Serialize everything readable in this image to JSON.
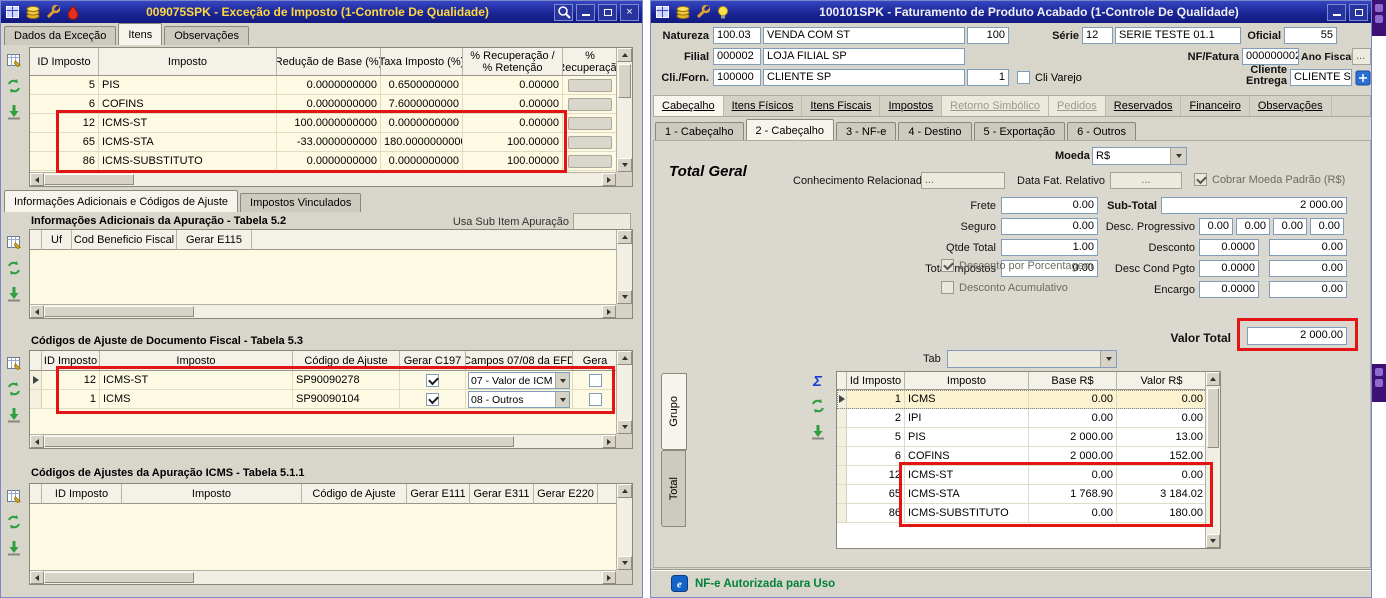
{
  "colors": {
    "highlight_red": "#e21414",
    "status_green": "#00833a",
    "titlebar_blue": "#1a2596",
    "grid_cream": "#fdf9e3"
  },
  "chrome": {
    "close_glyph": "×",
    "sum_icon_glyph": "Σ"
  },
  "left_window": {
    "title": "009075SPK - Exceção de Imposto (1-Controle De Qualidade)",
    "tabs": {
      "t1": "Dados da Exceção",
      "t2": "Itens",
      "t3": "Observações"
    },
    "impostos_grid": {
      "headers": {
        "id": "ID Imposto",
        "imposto": "Imposto",
        "reducao": "Redução de Base (%)",
        "taxa": "Taxa Imposto (%)",
        "recup_l1": "% Recuperação /",
        "recup_l2": "% Retenção",
        "recup2_l1": "%",
        "recup2_l2": "Recuperação"
      },
      "rows": [
        [
          "5",
          "PIS",
          "0.0000000000",
          "0.6500000000",
          "0.00000"
        ],
        [
          "6",
          "COFINS",
          "0.0000000000",
          "7.6000000000",
          "0.00000"
        ],
        [
          "12",
          "ICMS-ST",
          "100.0000000000",
          "0.0000000000",
          "0.00000"
        ],
        [
          "65",
          "ICMS-STA",
          "-33.0000000000",
          "180.0000000000",
          "100.00000"
        ],
        [
          "86",
          "ICMS-SUBSTITUTO",
          "0.0000000000",
          "0.0000000000",
          "100.00000"
        ]
      ]
    },
    "lower_tabs": {
      "t1": "Informações Adicionais e Códigos de Ajuste",
      "t2": "Impostos Vinculados"
    },
    "section_52": {
      "title": "Informações Adicionais da Apuração - Tabela 5.2",
      "right_label": "Usa Sub Item Apuração",
      "headers": {
        "uf": "Uf",
        "cod": "Cod Beneficio Fiscal",
        "e115": "Gerar E115"
      }
    },
    "section_53": {
      "title": "Códigos de Ajuste de Documento Fiscal - Tabela 5.3",
      "headers": {
        "id": "ID Imposto",
        "imposto": "Imposto",
        "codigo": "Código de Ajuste",
        "c197": "Gerar C197",
        "campos": "Campos 07/08 da EFD",
        "gera": "Gera"
      },
      "rows": [
        {
          "id": "12",
          "imposto": "ICMS-ST",
          "codigo": "SP90090278",
          "campos": "07 - Valor de ICM"
        },
        {
          "id": "1",
          "imposto": "ICMS",
          "codigo": "SP90090104",
          "campos": "08 - Outros"
        }
      ]
    },
    "section_511": {
      "title": "Códigos de Ajustes da Apuração ICMS - Tabela 5.1.1",
      "headers": {
        "id": "ID Imposto",
        "imposto": "Imposto",
        "codigo": "Código de Ajuste",
        "e111": "Gerar E111",
        "e311": "Gerar E311",
        "e220": "Gerar E220"
      }
    }
  },
  "right_window": {
    "title": "100101SPK - Faturamento de Produto Acabado (1-Controle De Qualidade)",
    "header_form": {
      "natureza_label": "Natureza",
      "natureza_code": "100.03",
      "natureza_desc": "VENDA COM ST",
      "natureza_num": "100",
      "serie_label": "Série",
      "serie_code": "12",
      "serie_desc": "SERIE TESTE 01.1",
      "oficial_label": "Oficial",
      "oficial_value": "55",
      "filial_label": "Filial",
      "filial_code": "000002",
      "filial_desc": "LOJA FILIAL SP",
      "nf_label": "NF/Fatura",
      "nf_value": "000000002",
      "ano_label": "Ano Fiscal",
      "ano_value": "...",
      "cli_label": "Cli./Forn.",
      "cli_code": "100000",
      "cli_desc": "CLIENTE SP",
      "cli_num": "1",
      "cli_varejo_label": "Cli Varejo",
      "entrega_l1": "Cliente",
      "entrega_l2": "Entrega",
      "entrega_value": "CLIENTE SP"
    },
    "main_tabs": [
      "Cabeçalho",
      "Itens Físicos",
      "Itens Fiscais",
      "Impostos",
      "Retorno Simbólico",
      "Pedidos",
      "Reservados",
      "Financeiro",
      "Observações"
    ],
    "sub_tabs": [
      "1 - Cabeçalho",
      "2 - Cabeçalho",
      "3 - NF-e",
      "4 - Destino",
      "5 - Exportação",
      "6 - Outros"
    ],
    "totals": {
      "moeda_label": "Moeda",
      "moeda_value": "R$",
      "section_title": "Total Geral",
      "conhecimento_label": "Conhecimento Relacionado",
      "conhecimento_value": "...",
      "data_fat_label": "Data Fat. Relativo",
      "data_fat_value": "...",
      "cobrar_moeda_label": "Cobrar Moeda Padrão (R$)",
      "frete_label": "Frete",
      "frete_value": "0.00",
      "seguro_label": "Seguro",
      "seguro_value": "0.00",
      "qtde_label": "Qtde Total",
      "qtde_value": "1.00",
      "impostos_label": "Total Impostos",
      "impostos_value": "0.00",
      "subtotal_label": "Sub-Total",
      "subtotal_value": "2 000.00",
      "desc_prog_label": "Desc. Progressivo",
      "desc_prog_values": [
        "0.00",
        "0.00",
        "0.00",
        "0.00"
      ],
      "desconto_label": "Desconto",
      "desconto_pct": "0.0000",
      "desconto_value": "0.00",
      "desc_cond_label": "Desc Cond Pgto",
      "desc_cond_pct": "0.0000",
      "desc_cond_value": "0.00",
      "encargo_label": "Encargo",
      "encargo_pct": "0.0000",
      "encargo_value": "0.00",
      "desc_porcentagem_label": "Desconto por Porcentagem",
      "desc_acumulativo_label": "Desconto Acumulativo",
      "valor_total_label": "Valor Total",
      "valor_total_value": "2 000.00",
      "tab_label": "Tab",
      "tab_value": ""
    },
    "grid": {
      "side_tabs": [
        "Grupo",
        "Total"
      ],
      "headers": {
        "id": "Id Imposto",
        "imposto": "Imposto",
        "base": "Base R$",
        "valor": "Valor R$"
      },
      "rows": [
        [
          "1",
          "ICMS",
          "0.00",
          "0.00"
        ],
        [
          "2",
          "IPI",
          "0.00",
          "0.00"
        ],
        [
          "5",
          "PIS",
          "2 000.00",
          "13.00"
        ],
        [
          "6",
          "COFINS",
          "2 000.00",
          "152.00"
        ],
        [
          "12",
          "ICMS-ST",
          "0.00",
          "0.00"
        ],
        [
          "65",
          "ICMS-STA",
          "1 768.90",
          "3 184.02"
        ],
        [
          "86",
          "ICMS-SUBSTITUTO",
          "0.00",
          "180.00"
        ]
      ]
    },
    "status": {
      "message": "NF-e Autorizada para Uso"
    }
  }
}
